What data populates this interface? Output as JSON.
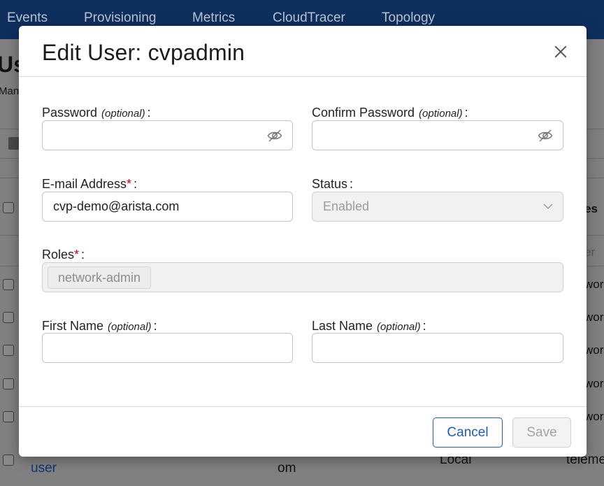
{
  "app": {
    "nav": [
      "Events",
      "Provisioning",
      "Metrics",
      "CloudTracer",
      "Topology"
    ],
    "page_title_fragment": "Us",
    "page_subtitle_fragment": "Man",
    "right_col_header": "es",
    "right_col_filter": "er",
    "right_col_cells": [
      "wor",
      "wor",
      "wor",
      "wor",
      "wor"
    ],
    "bottom_row": {
      "user": "user",
      "email_fragment": "om",
      "type": "Local",
      "role_fragment": "teleme"
    }
  },
  "modal": {
    "title": "Edit User: cvpadmin",
    "password": {
      "label": "Password",
      "optional": "(optional)",
      "value": ""
    },
    "confirm_password": {
      "label": "Confirm Password",
      "optional": "(optional)",
      "value": ""
    },
    "email": {
      "label": "E-mail Address",
      "required_mark": "*",
      "value": "cvp-demo@arista.com"
    },
    "status": {
      "label": "Status",
      "value": "Enabled"
    },
    "roles": {
      "label": "Roles",
      "required_mark": "*",
      "values": [
        "network-admin"
      ]
    },
    "first_name": {
      "label": "First Name",
      "optional": "(optional)",
      "value": ""
    },
    "last_name": {
      "label": "Last Name",
      "optional": "(optional)",
      "value": ""
    },
    "colon": ":",
    "buttons": {
      "cancel": "Cancel",
      "save": "Save"
    }
  },
  "colors": {
    "primary": "#1d5cb8",
    "required": "#d0021b",
    "nav_bg": "#0e2f5d"
  },
  "icons": {
    "close": "close-icon",
    "password_visibility": "eye-off-icon",
    "dropdown": "chevron-down-icon"
  }
}
